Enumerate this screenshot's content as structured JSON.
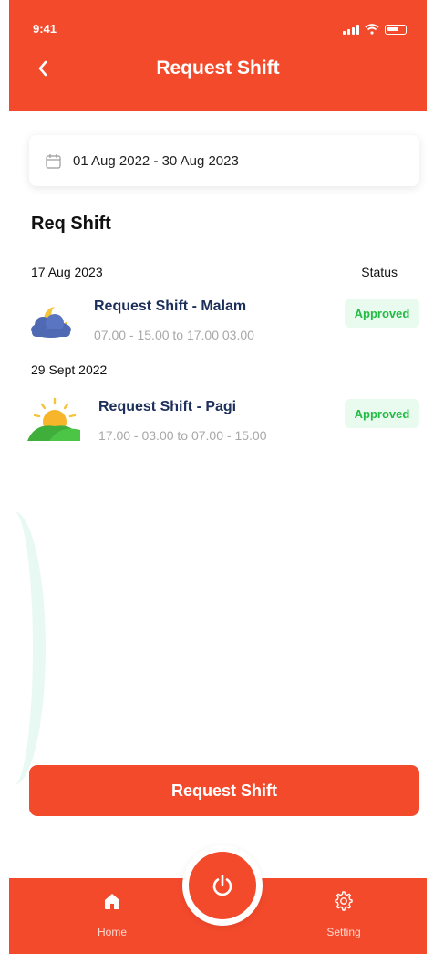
{
  "status_bar": {
    "time": "9:41"
  },
  "header": {
    "title": "Request Shift",
    "back_icon": "chevron-left-icon"
  },
  "date_range": {
    "icon": "calendar-icon",
    "value": "01 Aug 2022 - 30 Aug 2023"
  },
  "section": {
    "title": "Req Shift",
    "status_header": "Status"
  },
  "groups": [
    {
      "date": "17 Aug 2023",
      "item": {
        "icon": "moon-cloud-icon",
        "title": "Request Shift - Malam",
        "times": "07.00 - 15.00 to 17.00 03.00",
        "status": "Approved"
      }
    },
    {
      "date": "29 Sept 2022",
      "item": {
        "icon": "sunrise-icon",
        "title": "Request Shift - Pagi",
        "times": "17.00 - 03.00 to 07.00 - 15.00",
        "status": "Approved"
      }
    }
  ],
  "cta": {
    "label": "Request Shift"
  },
  "bottom_nav": {
    "home_label": "Home",
    "setting_label": "Setting",
    "center_icon": "power-icon"
  },
  "colors": {
    "primary": "#f34a2c",
    "approved_bg": "#e9faee",
    "approved_text": "#22bb44",
    "title_navy": "#1c2e5a"
  }
}
